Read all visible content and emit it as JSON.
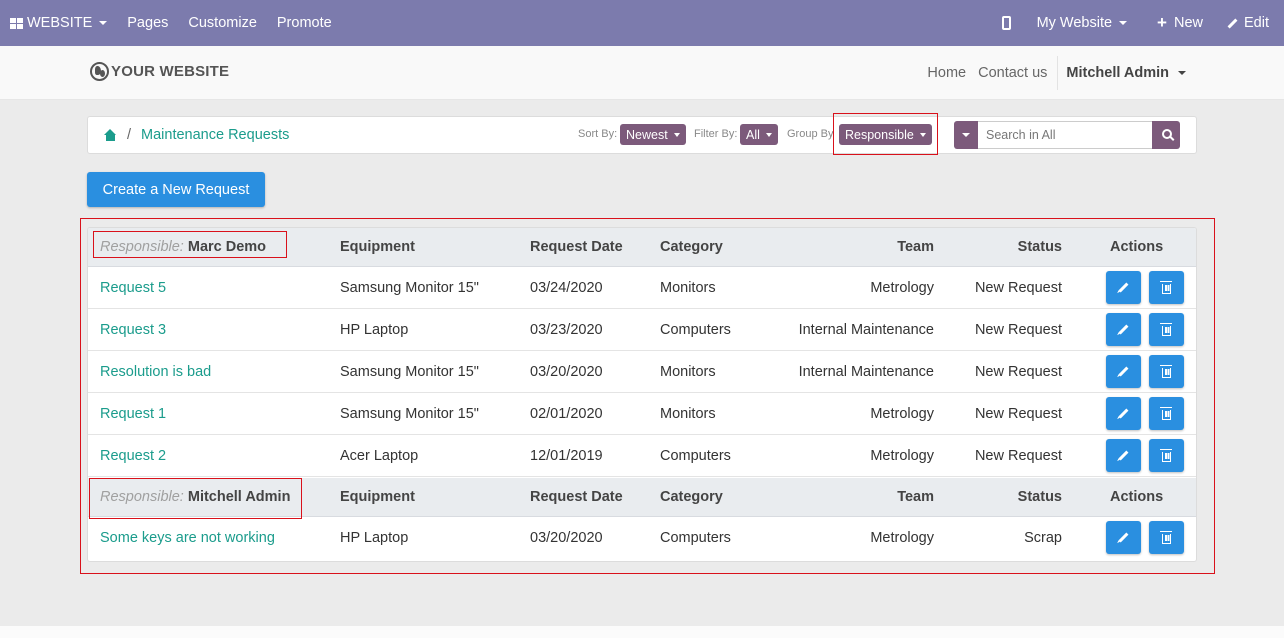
{
  "topbar": {
    "website_label": "WEBSITE",
    "pages": "Pages",
    "customize": "Customize",
    "promote": "Promote",
    "my_website": "My Website",
    "new": "New",
    "edit": "Edit"
  },
  "site": {
    "logo": "YOUR WEBSITE",
    "nav": {
      "home": "Home",
      "contact": "Contact us",
      "user": "Mitchell Admin"
    }
  },
  "breadcrumb": {
    "current": "Maintenance Requests"
  },
  "filters": {
    "sort_label": "Sort By:",
    "sort_value": "Newest",
    "filter_label": "Filter By:",
    "filter_value": "All",
    "group_label": "Group By",
    "group_value": "Responsible"
  },
  "search": {
    "placeholder": "Search in All"
  },
  "create_button": "Create a New Request",
  "columns": {
    "equipment": "Equipment",
    "request_date": "Request Date",
    "category": "Category",
    "team": "Team",
    "status": "Status",
    "actions": "Actions"
  },
  "groups": [
    {
      "label": "Responsible:",
      "name": "Marc Demo",
      "rows": [
        {
          "name": "Request 5",
          "equipment": "Samsung Monitor 15\"",
          "date": "03/24/2020",
          "category": "Monitors",
          "team": "Metrology",
          "status": "New Request"
        },
        {
          "name": "Request 3",
          "equipment": "HP Laptop",
          "date": "03/23/2020",
          "category": "Computers",
          "team": "Internal Maintenance",
          "status": "New Request"
        },
        {
          "name": "Resolution is bad",
          "equipment": "Samsung Monitor 15\"",
          "date": "03/20/2020",
          "category": "Monitors",
          "team": "Internal Maintenance",
          "status": "New Request"
        },
        {
          "name": "Request 1",
          "equipment": "Samsung Monitor 15\"",
          "date": "02/01/2020",
          "category": "Monitors",
          "team": "Metrology",
          "status": "New Request"
        },
        {
          "name": "Request 2",
          "equipment": "Acer Laptop",
          "date": "12/01/2019",
          "category": "Computers",
          "team": "Metrology",
          "status": "New Request"
        }
      ]
    },
    {
      "label": "Responsible:",
      "name": "Mitchell Admin",
      "rows": [
        {
          "name": "Some keys are not working",
          "equipment": "HP Laptop",
          "date": "03/20/2020",
          "category": "Computers",
          "team": "Metrology",
          "status": "Scrap"
        }
      ]
    }
  ],
  "colors": {
    "topbar": "#7c7bad",
    "accent": "#7c5a7b",
    "link": "#1b9c8c",
    "primary": "#2a8fe0",
    "highlight": "#d9111b"
  }
}
